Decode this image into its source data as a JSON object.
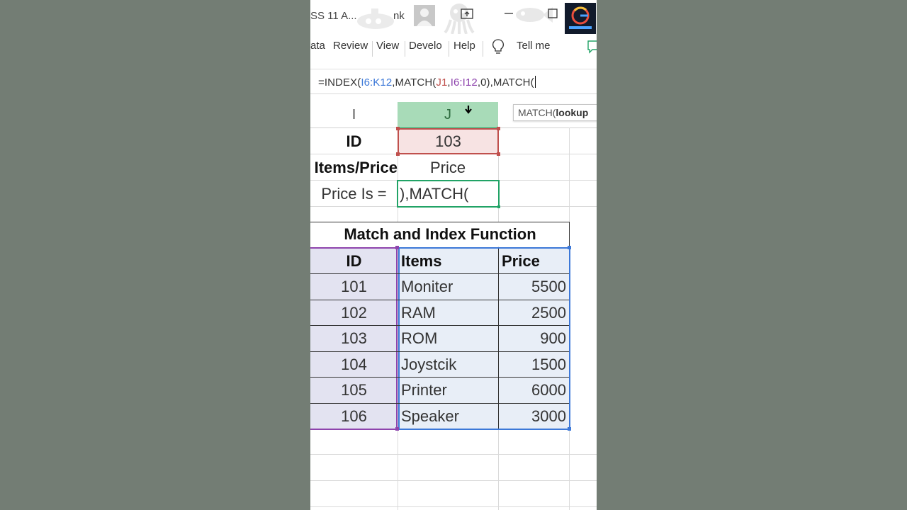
{
  "titlebar": {
    "doc_title": "SS 11 A...",
    "user_name": "nk"
  },
  "ribbon": {
    "tabs": [
      "ata",
      "Review",
      "View",
      "Develo",
      "Help"
    ],
    "tell_me": "Tell me"
  },
  "formula_bar": {
    "parts": [
      {
        "text": "=INDEX(",
        "color": "#333333"
      },
      {
        "text": "I6:K12",
        "color": "#3c78d8"
      },
      {
        "text": ",MATCH(",
        "color": "#333333"
      },
      {
        "text": "J1",
        "color": "#c0504d"
      },
      {
        "text": ",",
        "color": "#333333"
      },
      {
        "text": "I6:I12",
        "color": "#8e44ad"
      },
      {
        "text": ",0),MATCH(",
        "color": "#333333"
      }
    ]
  },
  "tooltip": {
    "prefix": "MATCH(",
    "arg": "lookup"
  },
  "columns": {
    "I": "I",
    "J": "J"
  },
  "lookup": {
    "id_label": "ID",
    "id_value": "103",
    "items_price_label": "Items/Price",
    "items_price_value": "Price",
    "price_is_label": "Price Is =",
    "editing_text": "),MATCH("
  },
  "table": {
    "title": "Match and Index Function",
    "headers": [
      "ID",
      "Items",
      "Price"
    ],
    "rows": [
      [
        "101",
        "Moniter",
        "5500"
      ],
      [
        "102",
        "RAM",
        "2500"
      ],
      [
        "103",
        "ROM",
        "900"
      ],
      [
        "104",
        "Joystcik",
        "1500"
      ],
      [
        "105",
        "Printer",
        "6000"
      ],
      [
        "106",
        "Speaker",
        "3000"
      ]
    ]
  },
  "colors": {
    "column_header_selected": "#a8dbb8",
    "selected_cell_border": "#21a366",
    "j1_reference": "#c0504d",
    "i_range_reference": "#8e44ad",
    "table_range_reference": "#3c78d8",
    "table_fill": "#e8eef7"
  }
}
